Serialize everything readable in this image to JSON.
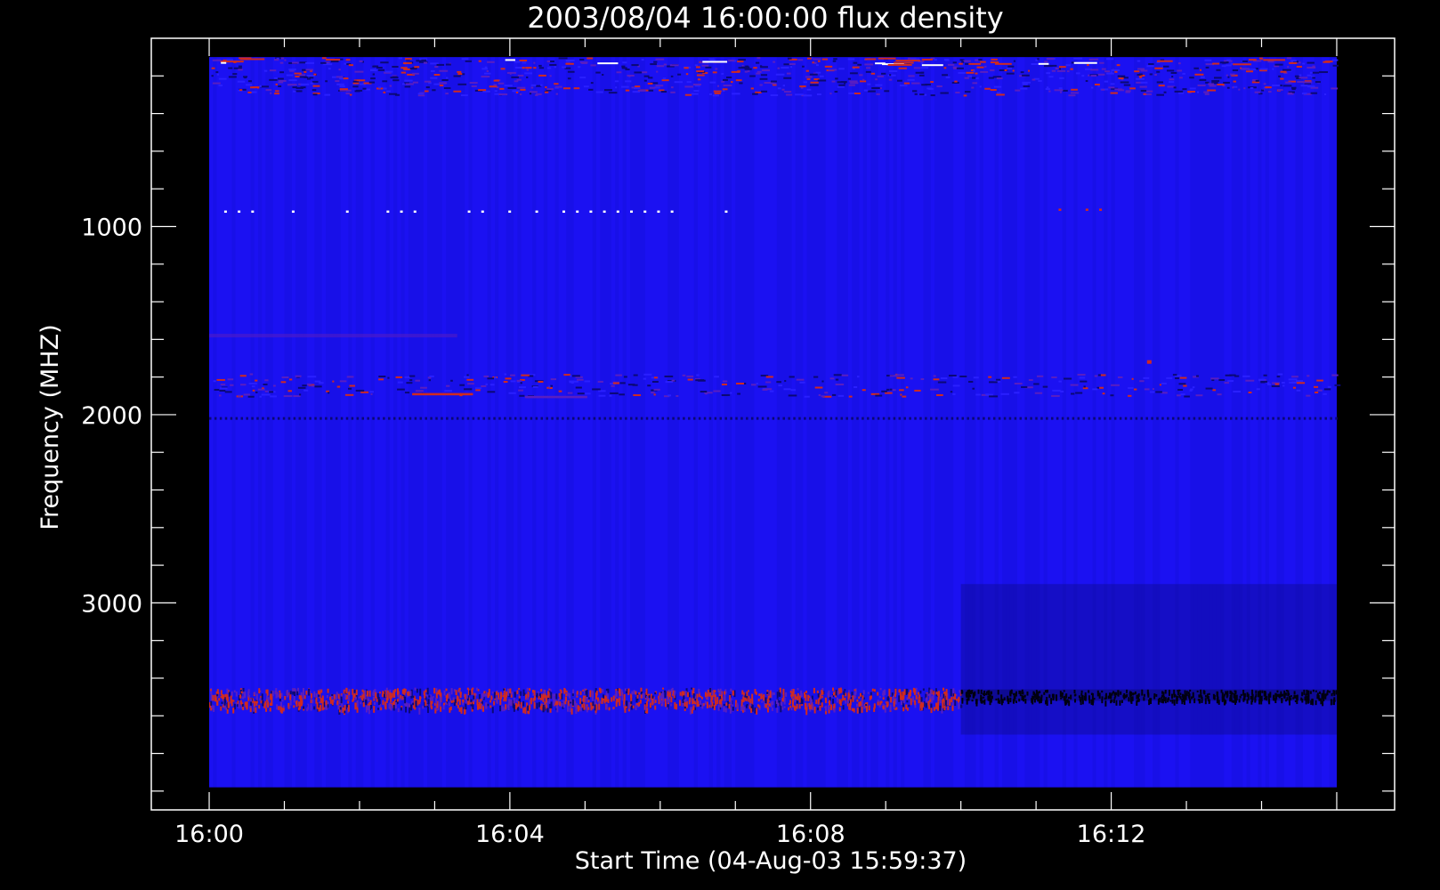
{
  "chart_data": {
    "type": "heatmap",
    "title": "2003/08/04 16:00:00 flux density",
    "xlabel": "Start Time (04-Aug-03 15:59:37)",
    "ylabel": "Frequency (MHZ)",
    "x": {
      "unit": "minutes after 16:00",
      "data_range": [
        0,
        15
      ],
      "axis_range": [
        -0.77,
        15.77
      ],
      "major_ticks": [
        0,
        4,
        8,
        12
      ],
      "major_tick_labels": [
        "16:00",
        "16:04",
        "16:08",
        "16:12"
      ],
      "minor_tick_step": 1
    },
    "y": {
      "unit": "MHz",
      "inverted": true,
      "data_range": [
        100,
        3980
      ],
      "axis_range": [
        0,
        4100
      ],
      "major_ticks": [
        1000,
        2000,
        3000
      ],
      "major_tick_labels": [
        "1000",
        "2000",
        "3000"
      ],
      "minor_tick_step": 200
    },
    "colors": {
      "background": "#000000",
      "axes": "#ffffff",
      "base": "#1a10f0",
      "dark": "#0b0875",
      "hot": "#d02a20",
      "mid": "#5a1ec0",
      "white": "#ffffff"
    },
    "features": [
      {
        "kind": "noisy-band",
        "freq": [
          100,
          300
        ],
        "time": [
          0,
          15
        ],
        "level": "high"
      },
      {
        "kind": "dotted-line",
        "freq": 920,
        "time": [
          0.2,
          7.0
        ],
        "color": "white"
      },
      {
        "kind": "dotted-line",
        "freq": 910,
        "time": [
          11.3,
          11.9
        ],
        "color": "hot"
      },
      {
        "kind": "faint-line",
        "freq": 1580,
        "time": [
          0,
          3.3
        ]
      },
      {
        "kind": "patchy-band",
        "freq": [
          1780,
          1900
        ],
        "time": [
          0,
          15
        ]
      },
      {
        "kind": "dashed-line",
        "freq": 1890,
        "time": [
          2.7,
          3.5
        ],
        "color": "hot"
      },
      {
        "kind": "dashed-line",
        "freq": 1905,
        "time": [
          4.2,
          5.0
        ],
        "color": "mid"
      },
      {
        "kind": "dark-dotted-line",
        "freq": 2020,
        "time": [
          0,
          15
        ]
      },
      {
        "kind": "dark-region",
        "freq": [
          2900,
          3700
        ],
        "time": [
          10.0,
          15
        ]
      },
      {
        "kind": "hot-band",
        "freq": [
          3450,
          3560
        ],
        "time": [
          0,
          10.0
        ]
      },
      {
        "kind": "dark-band",
        "freq": [
          3460,
          3520
        ],
        "time": [
          10.0,
          15
        ]
      },
      {
        "kind": "spot",
        "freq": 1720,
        "time": 12.5,
        "color": "hot"
      }
    ]
  }
}
